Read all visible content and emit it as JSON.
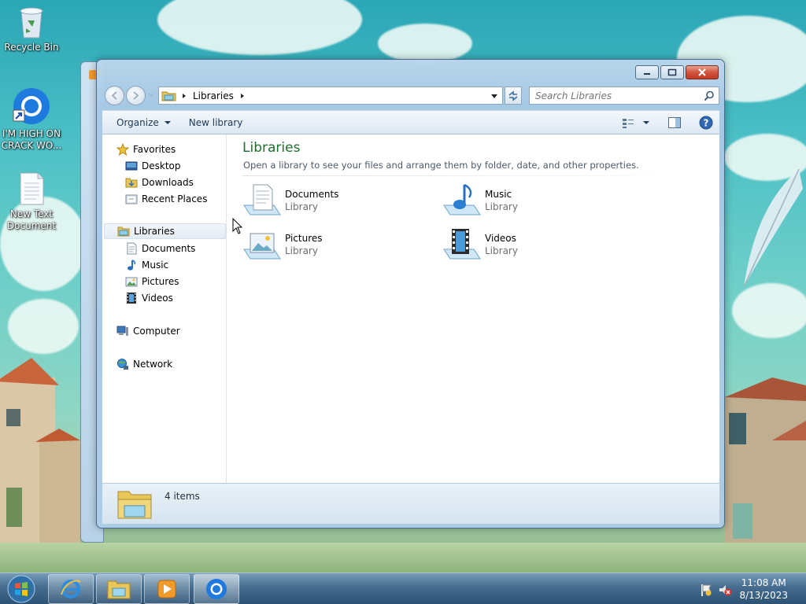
{
  "desktop": {
    "icons": [
      {
        "label": "Recycle Bin"
      },
      {
        "label": "I'M HIGH ON CRACK WO..."
      },
      {
        "label": "New Text Document"
      }
    ]
  },
  "window": {
    "breadcrumb": [
      "Libraries"
    ],
    "search_placeholder": "Search Libraries",
    "toolbar": {
      "organize": "Organize",
      "new_library": "New library"
    },
    "nav": {
      "favorites": "Favorites",
      "favorites_items": [
        "Desktop",
        "Downloads",
        "Recent Places"
      ],
      "libraries": "Libraries",
      "libraries_items": [
        "Documents",
        "Music",
        "Pictures",
        "Videos"
      ],
      "computer": "Computer",
      "network": "Network"
    },
    "main": {
      "title": "Libraries",
      "description": "Open a library to see your files and arrange them by folder, date, and other properties.",
      "libraries": [
        {
          "name": "Documents",
          "type": "Library"
        },
        {
          "name": "Music",
          "type": "Library"
        },
        {
          "name": "Pictures",
          "type": "Library"
        },
        {
          "name": "Videos",
          "type": "Library"
        }
      ]
    },
    "details": {
      "count": "4 items"
    }
  },
  "taskbar": {
    "clock": {
      "time": "11:08 AM",
      "date": "8/13/2023"
    }
  },
  "colors": {
    "accent_title": "#1e6f2b",
    "link_text": "#1e395b",
    "taskbar": "#3f6a8e"
  }
}
